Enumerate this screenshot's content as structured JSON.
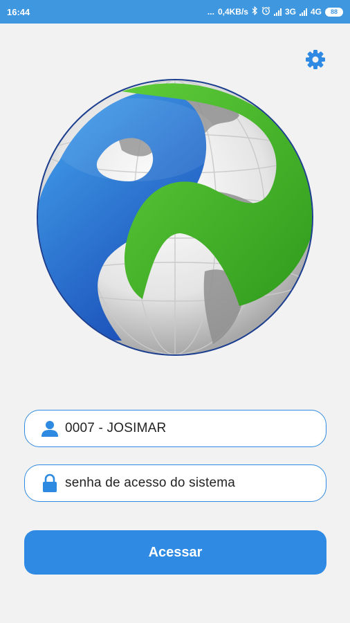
{
  "status_bar": {
    "time": "16:44",
    "dots": "...",
    "speed": "0,4KB/s",
    "network_1": "3G",
    "network_2": "4G",
    "battery": "88",
    "icons": [
      "bluetooth-icon",
      "alarm-icon",
      "signal-icon",
      "signal-icon",
      "battery-icon"
    ]
  },
  "settings": {
    "icon": "gear-icon"
  },
  "login": {
    "user_value": "0007 - JOSIMAR",
    "password_placeholder": "senha de acesso do sistema",
    "submit_label": "Acessar"
  },
  "colors": {
    "status_bar": "#3f97df",
    "primary": "#2f8ae3",
    "logo_blue": "#2178d4",
    "logo_green": "#4cb82e",
    "background": "#f2f2f2"
  }
}
